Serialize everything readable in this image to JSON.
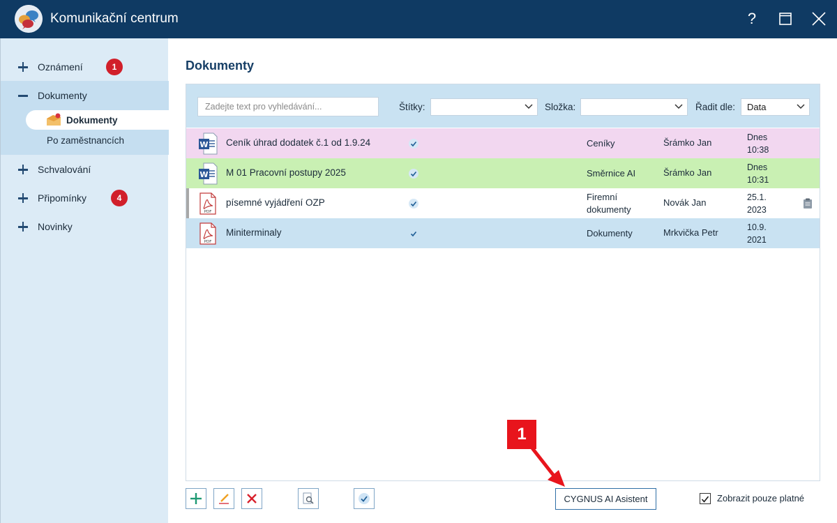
{
  "window": {
    "title": "Komunikační centrum",
    "help_label": "?"
  },
  "sidebar": {
    "items": [
      {
        "label": "Oznámení",
        "badge": "1",
        "expanded": false
      },
      {
        "label": "Dokumenty",
        "expanded": true
      },
      {
        "label": "Schvalování",
        "expanded": false
      },
      {
        "label": "Připomínky",
        "badge": "4",
        "expanded": false
      },
      {
        "label": "Novinky",
        "expanded": false
      }
    ],
    "sub_items": [
      {
        "label": "Dokumenty",
        "active": true
      },
      {
        "label": "Po zaměstnancích",
        "active": false
      }
    ]
  },
  "main": {
    "title": "Dokumenty",
    "filters": {
      "search_placeholder": "Zadejte text pro vyhledávání...",
      "tags_label": "Štítky:",
      "tags_value": "",
      "folder_label": "Složka:",
      "folder_value": "",
      "sort_label": "Řadit dle:",
      "sort_value": "Data"
    },
    "rows": [
      {
        "type": "word",
        "name": "Ceník úhrad dodatek č.1 od 1.9.24",
        "folder_lines": [
          "Ceníky"
        ],
        "author": "Šrámko Jan",
        "date_lines": [
          "Dnes",
          "10:38"
        ],
        "bg": "#f2d7f0"
      },
      {
        "type": "word",
        "name": "M 01 Pracovní postupy 2025",
        "folder_lines": [
          "Směrnice AI"
        ],
        "author": "Šrámko Jan",
        "date_lines": [
          "Dnes",
          "10:31"
        ],
        "bg": "#c9f0b3"
      },
      {
        "type": "pdf",
        "name": "písemné vyjádření OZP",
        "folder_lines": [
          "Firemní",
          "dokumenty"
        ],
        "author": "Novák Jan",
        "date_lines": [
          "25.1.",
          "2023"
        ],
        "bg": "#ffffff",
        "has_clip": true
      },
      {
        "type": "pdf",
        "name": "Miniterminaly",
        "folder_lines": [
          "Dokumenty"
        ],
        "author": "Mrkvička Petr",
        "date_lines": [
          "10.9.",
          "2021"
        ],
        "bg": "#c9e2f2"
      }
    ]
  },
  "toolbar": {
    "ai_assistant_label": "CYGNUS AI Asistent",
    "show_valid_label": "Zobrazit pouze platné",
    "show_valid_checked": true
  },
  "annotation": {
    "number": "1"
  },
  "colors": {
    "titlebar": "#0f3a63",
    "sidebar": "#dcebf6",
    "accent": "#173f66",
    "badge": "#d11f2a",
    "annotation": "#e8141c"
  }
}
